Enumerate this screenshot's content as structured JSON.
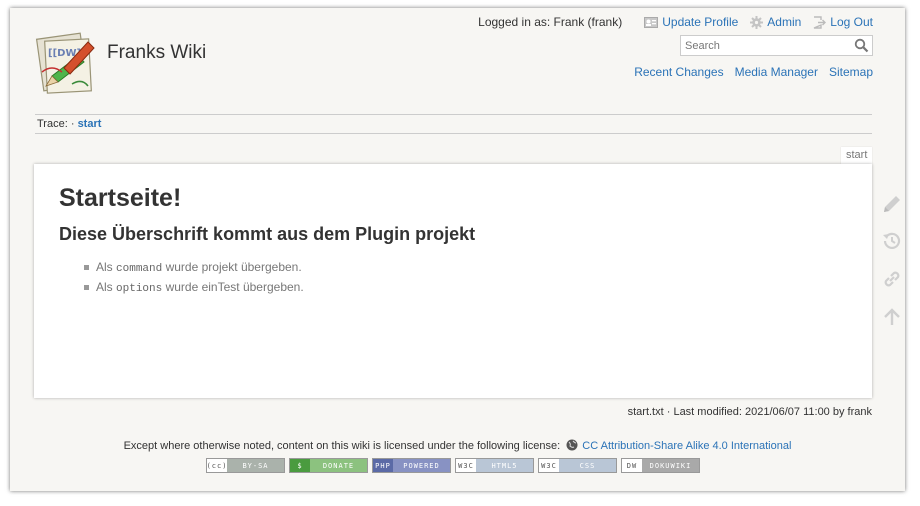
{
  "header": {
    "site_title": "Franks Wiki",
    "logged_in_label": "Logged in as: Frank (frank)",
    "user_tools": [
      {
        "label": "Update Profile",
        "icon": "profile-card-icon"
      },
      {
        "label": "Admin",
        "icon": "gear-icon"
      },
      {
        "label": "Log Out",
        "icon": "logout-icon"
      }
    ],
    "search_placeholder": "Search",
    "site_tools": [
      "Recent Changes",
      "Media Manager",
      "Sitemap"
    ]
  },
  "breadcrumb": {
    "prefix": "Trace:",
    "separator": "·",
    "current": "start"
  },
  "page": {
    "tab_label": "start",
    "heading1": "Startseite!",
    "heading2": "Diese Überschrift kommt aus dem Plugin projekt",
    "items": [
      {
        "pre": "Als",
        "code": "command",
        "post": "wurde projekt übergeben."
      },
      {
        "pre": "Als",
        "code": "options",
        "post": "wurde einTest übergeben."
      }
    ]
  },
  "page_tools": [
    "edit-pencil-icon",
    "history-icon",
    "backlinks-icon",
    "back-to-top-icon"
  ],
  "footer": {
    "docinfo": "start.txt · Last modified: 2021/06/07 11:00 by frank",
    "license_text": "Except where otherwise noted, content on this wiki is licensed under the following license:",
    "license_link": "CC Attribution-Share Alike 4.0 International",
    "badges": [
      {
        "left": "(cc)",
        "right": "BY-SA",
        "lcolor": "#ffffff",
        "rcolor": "#aab2ab"
      },
      {
        "left": "$",
        "right": "DONATE",
        "lcolor": "#4a9b3f",
        "rcolor": "#8cc27f"
      },
      {
        "left": "PHP",
        "right": "POWERED",
        "lcolor": "#5b6aa6",
        "rcolor": "#8892c3"
      },
      {
        "left": "W3C",
        "right": "HTML5",
        "lcolor": "#ffffff",
        "rcolor": "#b9c6d6"
      },
      {
        "left": "W3C",
        "right": "CSS",
        "lcolor": "#ffffff",
        "rcolor": "#b9c6d6"
      },
      {
        "left": "DW",
        "right": "DOKUWIKI",
        "lcolor": "#ffffff",
        "rcolor": "#a9a9a9"
      }
    ]
  },
  "colors": {
    "link": "#2b73b7",
    "background": "#f7f6f3"
  }
}
